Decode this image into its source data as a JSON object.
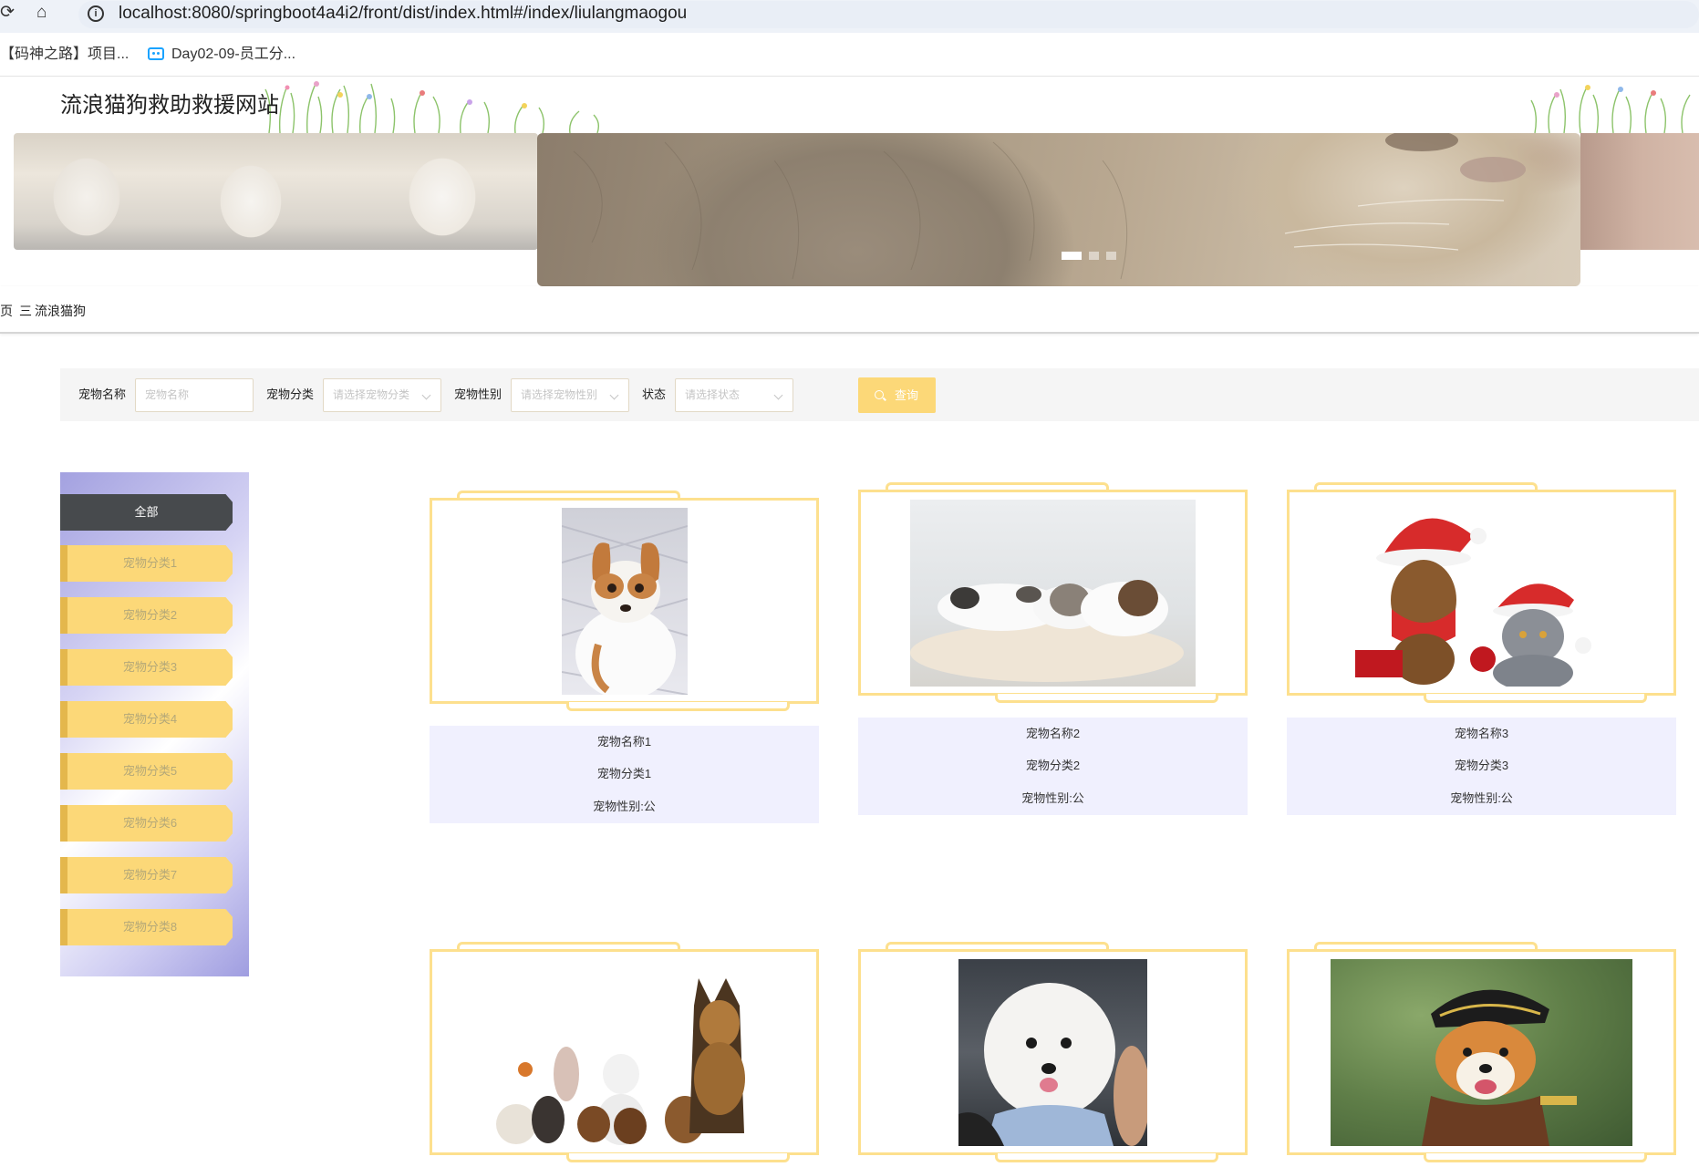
{
  "browser": {
    "url_host": "localhost",
    "url_rest": ":8080/springboot4a4i2/front/dist/index.html#/index/liulangmaogou",
    "bookmarks": [
      "【码神之路】项目...",
      "Day02-09-员工分..."
    ]
  },
  "header": {
    "site_title": "流浪猫狗救助救援网站"
  },
  "breadcrumb": {
    "home": "页",
    "separator": "三",
    "current": "流浪猫狗"
  },
  "search": {
    "name_label": "宠物名称",
    "name_placeholder": "宠物名称",
    "category_label": "宠物分类",
    "category_placeholder": "请选择宠物分类",
    "gender_label": "宠物性别",
    "gender_placeholder": "请选择宠物性别",
    "status_label": "状态",
    "status_placeholder": "请选择状态",
    "query_label": "查询"
  },
  "categories": {
    "all": "全部",
    "items": [
      "宠物分类1",
      "宠物分类2",
      "宠物分类3",
      "宠物分类4",
      "宠物分类5",
      "宠物分类6",
      "宠物分类7",
      "宠物分类8"
    ]
  },
  "pets": [
    {
      "name": "宠物名称1",
      "category": "宠物分类1",
      "gender": "宠物性别:公"
    },
    {
      "name": "宠物名称2",
      "category": "宠物分类2",
      "gender": "宠物性别:公"
    },
    {
      "name": "宠物名称3",
      "category": "宠物分类3",
      "gender": "宠物性别:公"
    }
  ],
  "carousel": {
    "slide_count": 3,
    "active_index": 0
  },
  "colors": {
    "accent_yellow": "#fcd878",
    "frame_yellow": "#fde08e",
    "category_active": "#474a4d",
    "info_bg": "#f0f0fe"
  }
}
